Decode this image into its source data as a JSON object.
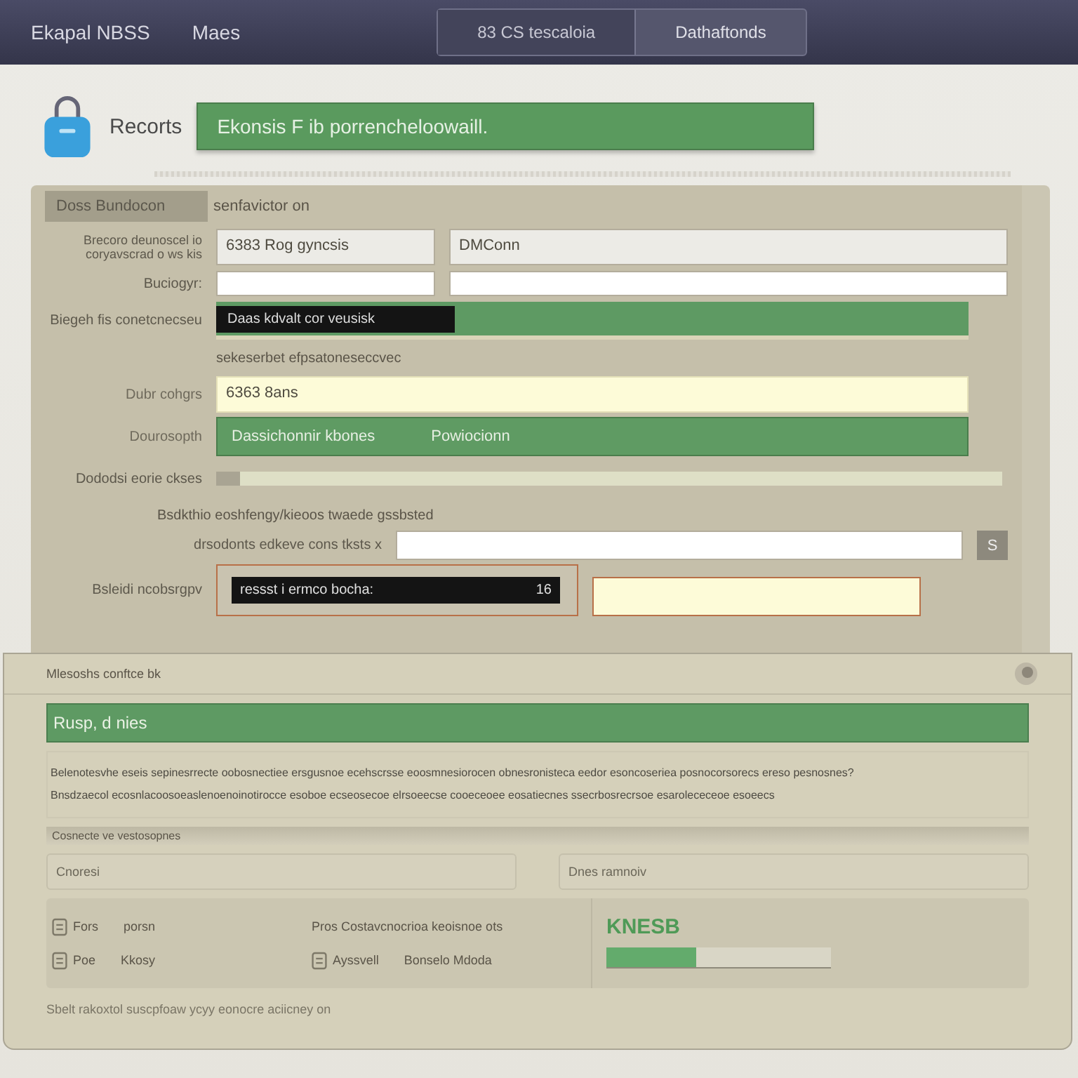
{
  "top_bar": {
    "app_name": "Ekapal NBSS",
    "menu": "Maes",
    "tabs": [
      {
        "label": "83 CS tescaloia",
        "selected": true
      },
      {
        "label": "Dathaftonds",
        "selected": false
      }
    ]
  },
  "header": {
    "title": "Recorts",
    "banner": "Ekonsis F ib porrencheloowaill."
  },
  "form": {
    "tab": "Doss Bundocon",
    "subtitle": "senfavictor on",
    "rows": [
      {
        "kind": "double",
        "label": "Brecoro deunoscel io coryavscrad o ws kis",
        "value": "6383 Rog gyncsis",
        "value2": "DMConn"
      },
      {
        "kind": "blank",
        "label": "Buciogyr:"
      },
      {
        "kind": "chip",
        "label": "Biegeh fis conetcnecseu",
        "chip": "Daas kdvalt cor veusisk",
        "caption": "sekeserbet efpsatoneseccvec"
      },
      {
        "kind": "note",
        "label": "Dubr cohgrs",
        "value": "6363 8ans"
      },
      {
        "kind": "green",
        "label": "Dourosopth",
        "text": "Dassichonnir kbones",
        "text2": "Powiocionn"
      },
      {
        "kind": "slider",
        "label": "Dododsi eorie ckses",
        "level": 0.03
      },
      {
        "kind": "search",
        "caption": "Bsdkthio eoshfengy/kieoos twaede gssbsted",
        "label": "drsodonts edkeve cons tksts x",
        "button": "S"
      },
      {
        "kind": "dark",
        "label": "Bsleidi ncobsrgpv",
        "value": "ressst i ermco bocha:",
        "suffix": "16"
      }
    ]
  },
  "details": {
    "title": "Mlesoshs conftce bk",
    "section": "Rusp, d nies",
    "paragraphs": [
      "Belenotesvhe eseis sepinesrrecte oobosnectiee ersgusnoe ecehscrsse eoosmnesiorocen obnesronisteca eedor esoncoseriea posnocorsorecs ereso pesnosnes?",
      "Bnsdzaecol ecosnlacoosoeaslenoenoinotirocce esoboe ecseosecoe elrsoeecse cooeceoee eosatiecnes ssecrbosrecrsoe esarolececeoe esoeecs"
    ],
    "note": "Cosnecte ve vestosopnes",
    "fields": [
      {
        "placeholder": "Cnoresi"
      },
      {
        "placeholder": "Dnes ramnoiv"
      }
    ],
    "options": [
      {
        "kind": "icon",
        "label": "Fors",
        "value": "porsn"
      },
      {
        "kind": "icon",
        "label": "Poe",
        "value": "Kkosy"
      },
      {
        "kind": "plain",
        "label": "Pros Costavcnocrioa keoisnoe ots"
      },
      {
        "kind": "icon",
        "label": "Ayssvell",
        "value": "Bonselo Mdoda"
      }
    ],
    "status": {
      "label": "KNESB",
      "level": 0.4
    },
    "footer": "Sbelt rakoxtol suscpfoaw ycyy eonocre aciicney on"
  }
}
